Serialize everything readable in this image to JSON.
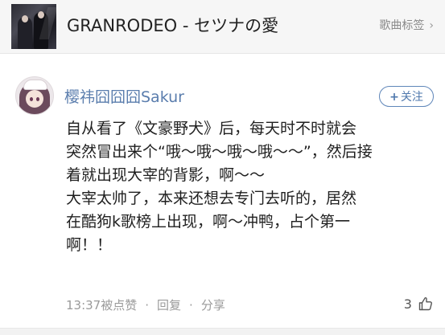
{
  "song": {
    "title": "GRANRODEO - セツナの愛",
    "tags_label": "歌曲标签",
    "tags_chevron": "›"
  },
  "comment": {
    "username": "樱祎囧囧囧Sakur",
    "follow_label": "关注",
    "follow_plus": "+",
    "lines": [
      "自从看了《文豪野犬》后，每天时不时就会",
      "突然冒出来个“哦～哦～哦～哦～～”，然后接",
      "着就出现大宰的背影，啊～～",
      "大宰太帅了，本来还想去专门去听的，居然",
      "在酷狗k歌榜上出现，啊～冲鸭，占个第一",
      "啊！！"
    ],
    "meta": {
      "time": "13:37",
      "liked_label": "被点赞",
      "reply_label": "回复",
      "share_label": "分享",
      "separator": "·"
    },
    "like_count": "3"
  },
  "colors": {
    "accent": "#5a7dad",
    "text": "#1f1f1f",
    "muted": "#9a9a9a"
  },
  "icons": {
    "like": "thumbs-up-icon",
    "follow": "plus-icon",
    "tags": "chevron-right-icon"
  }
}
